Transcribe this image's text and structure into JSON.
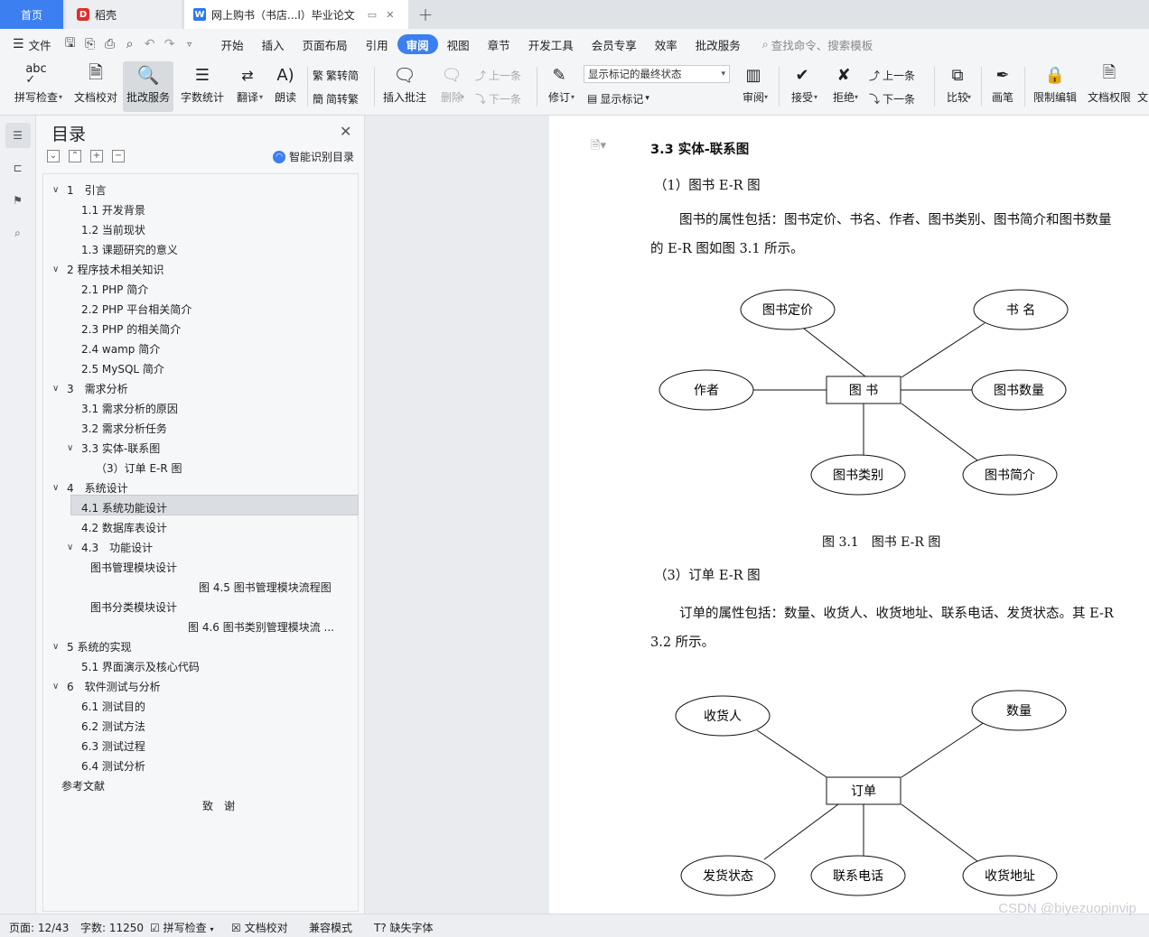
{
  "tabs": {
    "home": "首页",
    "daoke": "稻壳",
    "doc": "网上购书（书店...l）毕业论文"
  },
  "menu": {
    "file": "文件",
    "items": [
      "开始",
      "插入",
      "页面布局",
      "引用",
      "审阅",
      "视图",
      "章节",
      "开发工具",
      "会员专享",
      "效率",
      "批改服务"
    ],
    "active": "审阅",
    "search_placeholder": "查找命令、搜索模板"
  },
  "ribbon": {
    "spellcheck": "拼写检查",
    "doc_proof": "文档校对",
    "review_service": "批改服务",
    "word_count": "字数统计",
    "translate": "翻译",
    "read_aloud": "朗读",
    "to_traditional": "繁转简",
    "to_simplified": "简转繁",
    "insert_comment": "插入批注",
    "delete": "删除",
    "prev_comment": "上一条",
    "next_comment": "下一条",
    "revise": "修订",
    "markup_state": "显示标记的最终状态",
    "show_markup": "显示标记",
    "review": "审阅",
    "accept": "接受",
    "reject": "拒绝",
    "prev": "上一条",
    "next": "下一条",
    "compare": "比较",
    "pen": "画笔",
    "restrict_edit": "限制编辑",
    "doc_permission": "文档权限",
    "more": "文"
  },
  "toc": {
    "title": "目录",
    "smart": "智能识别目录",
    "items": [
      {
        "text": "1　引言",
        "level": 0,
        "chev": "∨"
      },
      {
        "text": "1.1  开发背景",
        "level": 1
      },
      {
        "text": "1.2  当前现状",
        "level": 1
      },
      {
        "text": "1.3  课题研究的意义",
        "level": 1
      },
      {
        "text": "2  程序技术相关知识",
        "level": 0,
        "chev": "∨"
      },
      {
        "text": "2.1 PHP 简介",
        "level": 1
      },
      {
        "text": "2.2 PHP  平台相关简介",
        "level": 1
      },
      {
        "text": "2.3 PHP 的相关简介",
        "level": 1
      },
      {
        "text": "2.4 wamp 简介",
        "level": 1
      },
      {
        "text": "2.5 MySQL 简介",
        "level": 1
      },
      {
        "text": "3　需求分析",
        "level": 0,
        "chev": "∨"
      },
      {
        "text": "3.1  需求分析的原因",
        "level": 1
      },
      {
        "text": "3.2 需求分析任务",
        "level": 1
      },
      {
        "text": "3.3 实体-联系图",
        "level": 1,
        "chev": "∨"
      },
      {
        "text": "（3）订单 E-R 图",
        "level": 2
      },
      {
        "text": "4　系统设计",
        "level": 0,
        "chev": "∨"
      },
      {
        "text": "4.1  系统功能设计",
        "level": 1
      },
      {
        "text": "4.2 数据库表设计",
        "level": 1
      },
      {
        "text": "4.3　功能设计",
        "level": 1,
        "chev": "∨"
      },
      {
        "text": "图书管理模块设计",
        "level": 3
      },
      {
        "text": "图 4.5 图书管理模块流程图",
        "level": 4
      },
      {
        "text": "图书分类模块设计",
        "level": 3
      },
      {
        "text": "图 4.6  图书类别管理模块流 ...",
        "level": 5
      },
      {
        "text": "5  系统的实现",
        "level": 0,
        "chev": "∨"
      },
      {
        "text": "5.1  界面演示及核心代码",
        "level": 1
      },
      {
        "text": "6　软件测试与分析",
        "level": 0,
        "chev": "∨"
      },
      {
        "text": "6.1  测试目的",
        "level": 1
      },
      {
        "text": "6.2  测试方法",
        "level": 1
      },
      {
        "text": "6.3  测试过程",
        "level": 1
      },
      {
        "text": "6.4  测试分析",
        "level": 1
      },
      {
        "text": "参考文献",
        "level": 6
      },
      {
        "text": "致　谢",
        "level": 7
      }
    ]
  },
  "document": {
    "heading": "3.3 实体-联系图",
    "sub1": "（1）图书 E-R 图",
    "para1_line1": "图书的属性包括：图书定价、书名、作者、图书类别、图书简介和图书数量",
    "para1_line2": "的 E-R 图如图 3.1 所示。",
    "fig1": {
      "entity": "图 书",
      "attributes": [
        "图书定价",
        "书  名",
        "作者",
        "图书数量",
        "图书类别",
        "图书简介"
      ],
      "caption": "图 3.1　图书 E-R 图"
    },
    "sub3": "（3）订单 E-R 图",
    "para2_line1": "订单的属性包括：数量、收货人、收货地址、联系电话、发货状态。其 E-R",
    "para2_line2": "3.2 所示。",
    "fig2": {
      "entity": "订单",
      "attributes": [
        "收货人",
        "数量",
        "发货状态",
        "联系电话",
        "收货地址"
      ]
    }
  },
  "status": {
    "page": "页面: 12/43",
    "words": "字数: 11250",
    "spell": "拼写检查",
    "proof": "文档校对",
    "compat": "兼容模式",
    "missing_font": "缺失字体"
  },
  "watermark": "CSDN @biyezuopinvip",
  "colors": {
    "accent": "#3c7ff0",
    "brand_red": "#e02d2d"
  }
}
